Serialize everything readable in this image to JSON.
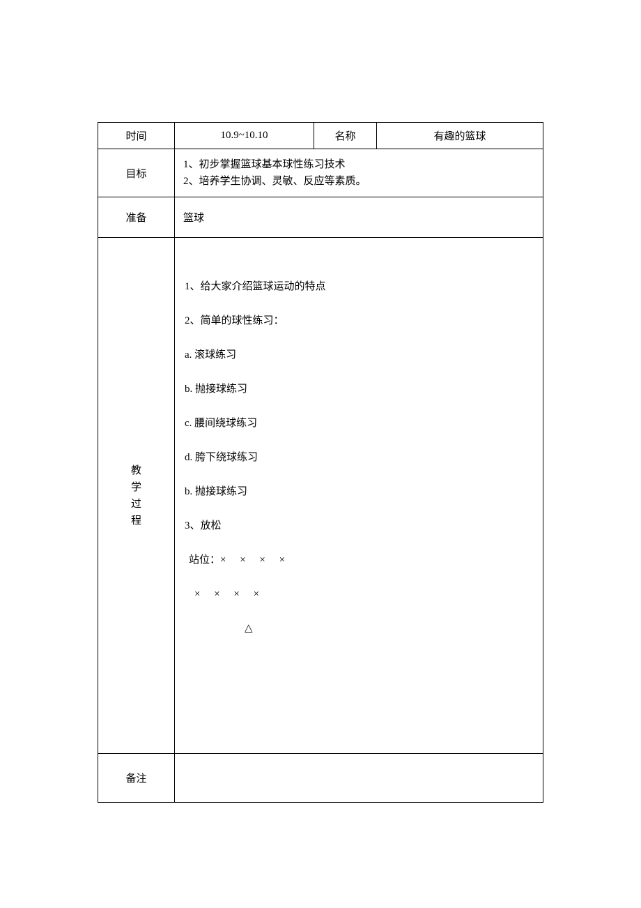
{
  "header": {
    "time_label": "时间",
    "time_value": "10.9~10.10",
    "name_label": "名称",
    "name_value": "有趣的篮球"
  },
  "goals": {
    "label": "目标",
    "line1": "1、初步掌握篮球基本球性练习技术",
    "line2": "2、培养学生协调、灵敏、反应等素质。"
  },
  "prep": {
    "label": "准备",
    "value": "篮球"
  },
  "process": {
    "label_chars": [
      "教",
      "学",
      "过",
      "程"
    ],
    "lines": {
      "l1": "1、给大家介绍篮球运动的特点",
      "l2": "2、简单的球性练习：",
      "l3": "a. 滚球练习",
      "l4": "b. 抛接球练习",
      "l5": "c. 腰间绕球练习",
      "l6": "d. 胯下绕球练习",
      "l7": "b. 抛接球练习",
      "l8": "3、放松",
      "formation1": " 站位：× × × ×",
      "formation2": " × × × ×",
      "formation3": "△"
    }
  },
  "notes": {
    "label": "备注",
    "value": ""
  }
}
